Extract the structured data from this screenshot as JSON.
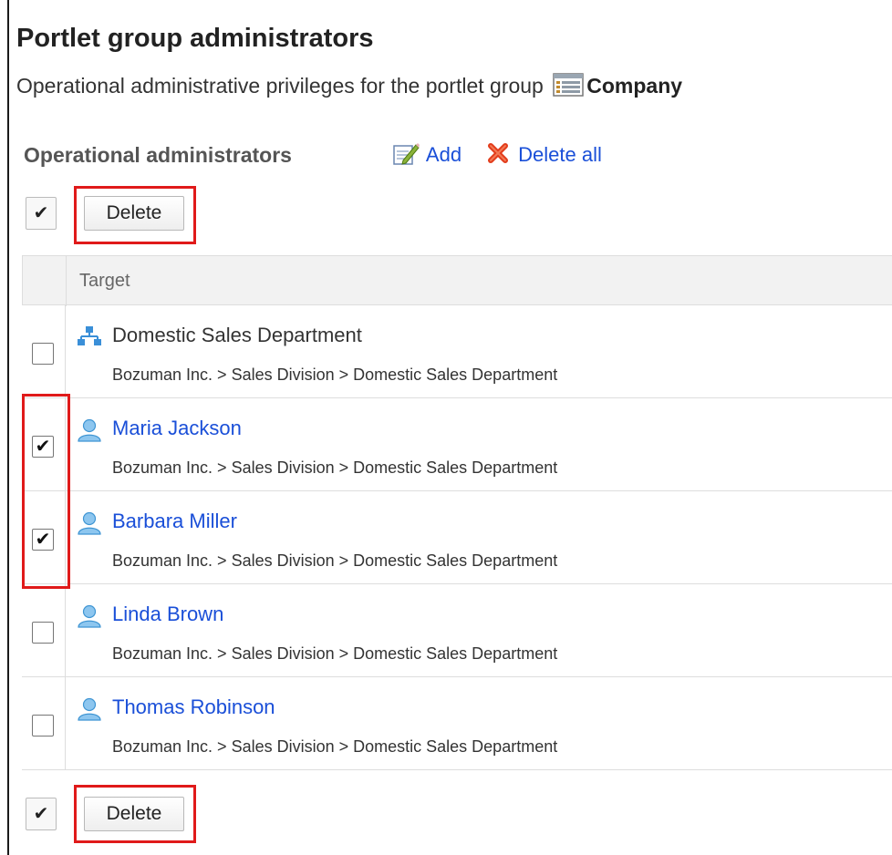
{
  "header": {
    "title": "Portlet group administrators",
    "description": "Operational administrative privileges for the portlet group",
    "group_name": "Company"
  },
  "section": {
    "title": "Operational administrators",
    "add_label": "Add",
    "delete_all_label": "Delete all"
  },
  "toolbar": {
    "check_all_label": "✔",
    "delete_label": "Delete"
  },
  "table": {
    "header_target": "Target",
    "rows": [
      {
        "name": "Domestic Sales Department",
        "path": "Bozuman Inc. > Sales Division > Domestic Sales Department",
        "type": "organization",
        "checked": false
      },
      {
        "name": "Maria Jackson",
        "path": "Bozuman Inc. > Sales Division > Domestic Sales Department",
        "type": "user",
        "checked": true
      },
      {
        "name": "Barbara Miller",
        "path": "Bozuman Inc. > Sales Division > Domestic Sales Department",
        "type": "user",
        "checked": true
      },
      {
        "name": "Linda Brown",
        "path": "Bozuman Inc. > Sales Division > Domestic Sales Department",
        "type": "user",
        "checked": false
      },
      {
        "name": "Thomas Robinson",
        "path": "Bozuman Inc. > Sales Division > Domestic Sales Department",
        "type": "user",
        "checked": false
      }
    ]
  },
  "colors": {
    "link": "#1a4fd8",
    "highlight": "#e01a1a",
    "header_bg": "#f2f2f2"
  },
  "icons": {
    "portlet_group": "portlet-group-icon",
    "add": "edit-icon",
    "delete_all": "red-x-icon",
    "organization": "org-chart-icon",
    "user": "user-icon"
  }
}
